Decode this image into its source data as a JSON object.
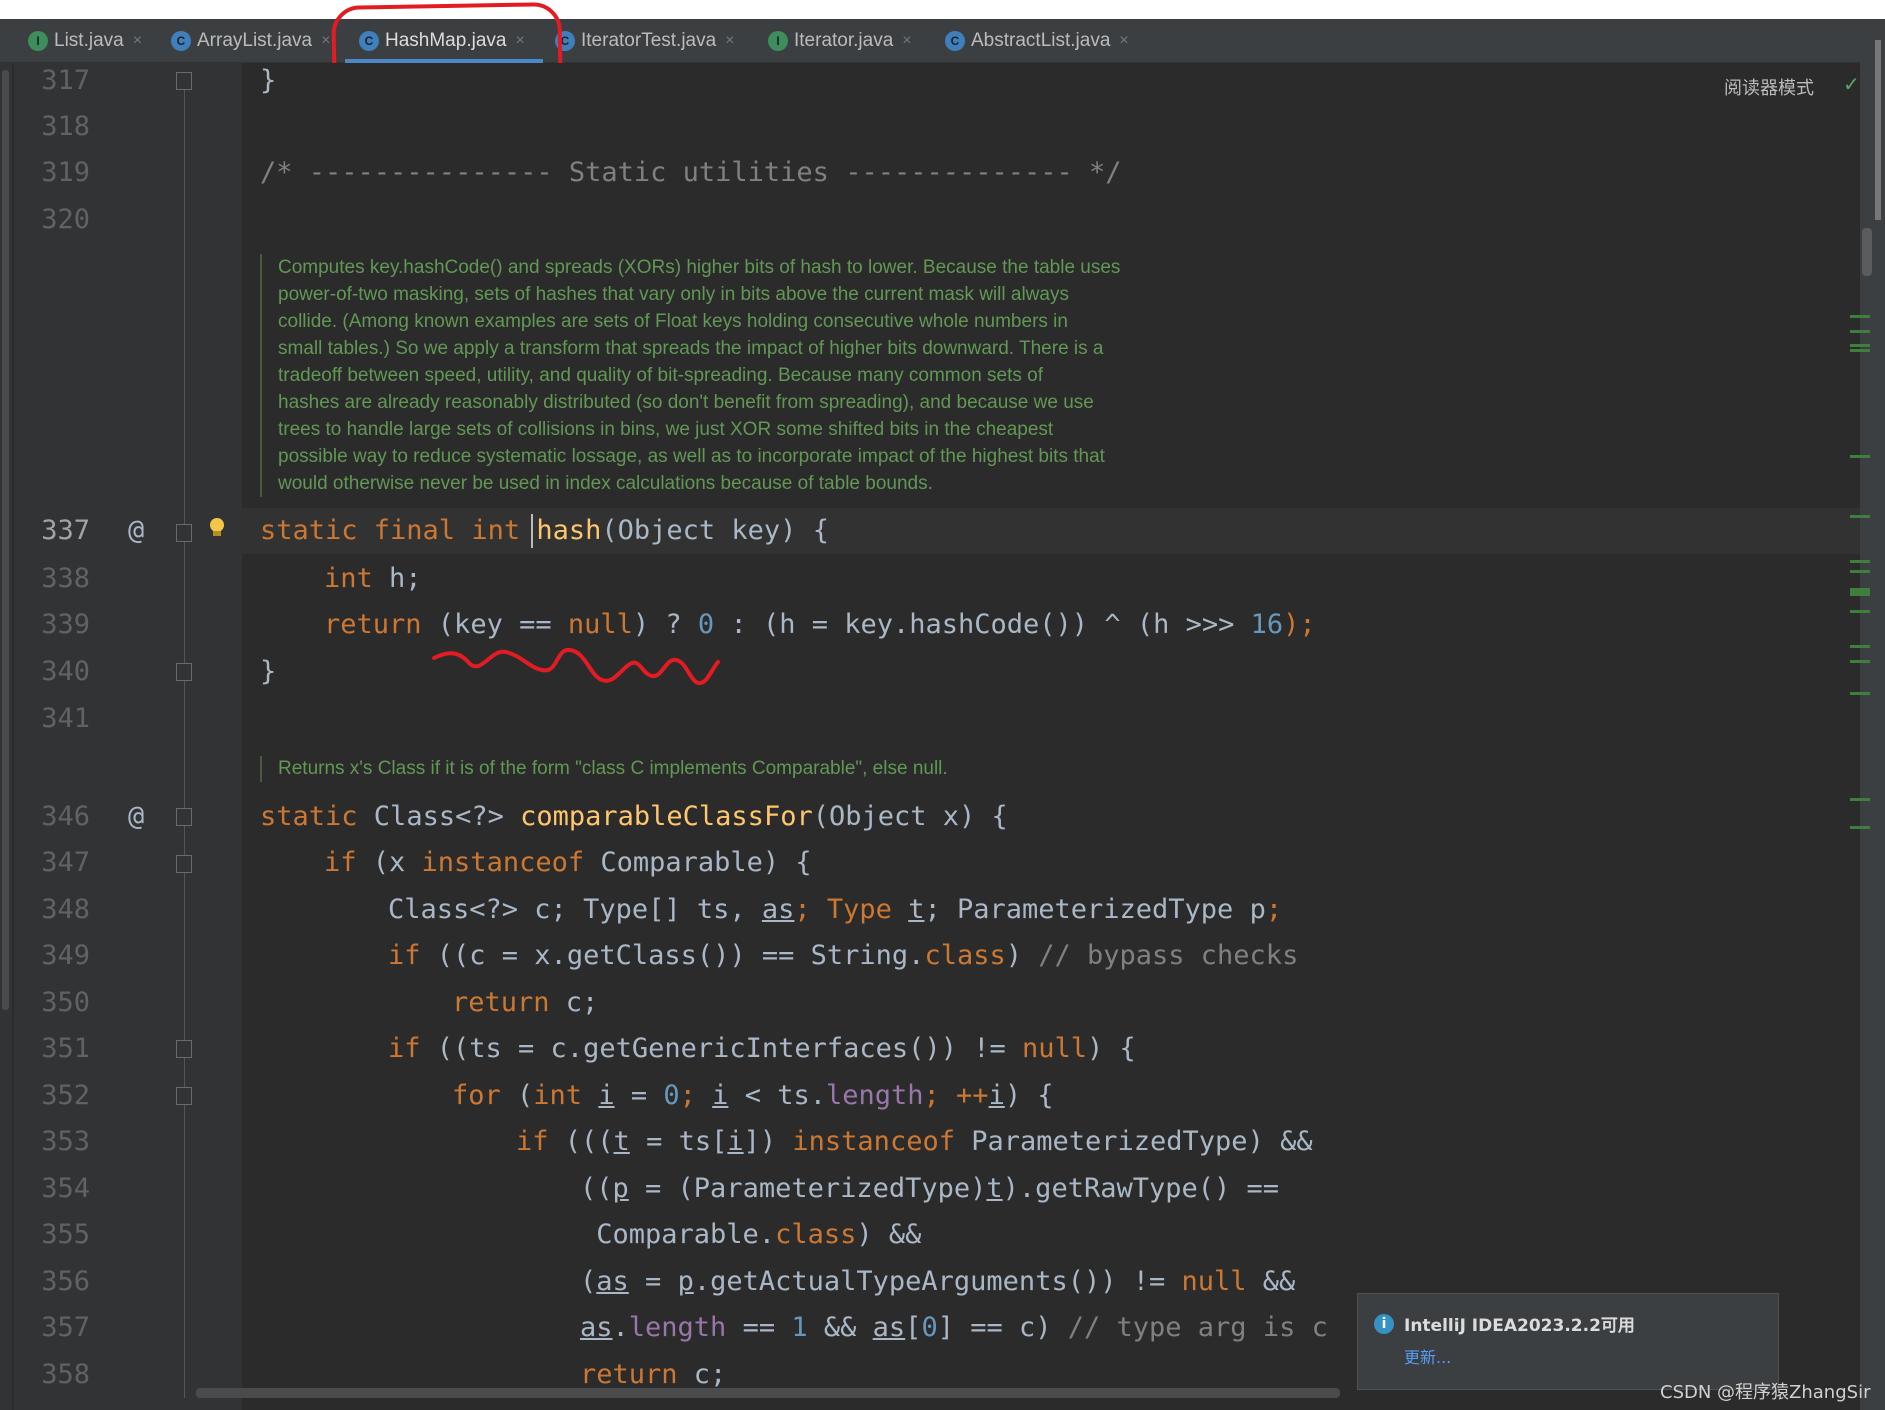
{
  "tabs": [
    {
      "label": "List.java",
      "icon": "interface-icon",
      "icon_letter": "I"
    },
    {
      "label": "ArrayList.java",
      "icon": "class-icon",
      "icon_letter": "C"
    },
    {
      "label": "HashMap.java",
      "icon": "class-icon",
      "icon_letter": "C"
    },
    {
      "label": "IteratorTest.java",
      "icon": "class-icon",
      "icon_letter": "C"
    },
    {
      "label": "Iterator.java",
      "icon": "interface-icon",
      "icon_letter": "I"
    },
    {
      "label": "AbstractList.java",
      "icon": "abstract-class-icon",
      "icon_letter": "C"
    }
  ],
  "active_tab": "HashMap.java",
  "reader_mode": "阅读器模式",
  "line_numbers": [
    "317",
    "318",
    "319",
    "320",
    "337",
    "338",
    "339",
    "340",
    "341",
    "346",
    "347",
    "348",
    "349",
    "350",
    "351",
    "352",
    "353",
    "354",
    "355",
    "356",
    "357",
    "358"
  ],
  "doc_hash": "Computes key.hashCode() and spreads (XORs) higher bits of hash to lower. Because the table uses\npower-of-two masking, sets of hashes that vary only in bits above the current mask will always\ncollide. (Among known examples are sets of Float keys holding consecutive whole numbers in\nsmall tables.) So we apply a transform that spreads the impact of higher bits downward. There is a\ntradeoff between speed, utility, and quality of bit-spreading. Because many common sets of\nhashes are already reasonably distributed (so don't benefit from spreading), and because we use\ntrees to handle large sets of collisions in bins, we just XOR some shifted bits in the cheapest\npossible way to reduce systematic lossage, as well as to incorporate impact of the highest bits that\nwould otherwise never be used in index calculations because of table bounds.",
  "doc_comparable": "Returns x's Class if it is of the form \"class C implements Comparable\", else null.",
  "code": {
    "l317": "}",
    "l319": "/* --------------- Static utilities -------------- */",
    "l337": {
      "kw": "static final int ",
      "fn": "hash",
      "rest": "(Object key) {"
    },
    "l338": {
      "kw": "int",
      "rest": " h;"
    },
    "l339": {
      "kw": "return",
      "a": " (key == ",
      "null": "null",
      "b": ") ? ",
      "n0": "0",
      "c": " : (h = key.hashCode()) ^ (h >>> ",
      "n16": "16",
      "d": ");"
    },
    "l340": "}",
    "l346": {
      "kw": "static",
      "a": " Class<?> ",
      "fn": "comparableClassFor",
      "rest": "(Object x) {"
    },
    "l347": {
      "kw": "if",
      "a": " (x ",
      "inst": "instanceof",
      "rest": " Comparable) {"
    },
    "l348": {
      "a": "Class<?> c; Type[] ts, ",
      "as": "as",
      "b": "; Type ",
      "t": "t",
      "c": "; ParameterizedType ",
      "p": "p",
      "d": ";"
    },
    "l349": {
      "kw": "if",
      "a": " ((c = x.getClass()) == String.",
      "cls": "class",
      "b": ") ",
      "cmt": "// bypass checks"
    },
    "l350": {
      "kw": "return",
      "rest": " c;"
    },
    "l351": {
      "kw": "if",
      "a": " ((ts = c.getGenericInterfaces()) != ",
      "null": "null",
      "b": ") {"
    },
    "l352": {
      "kw": "for",
      "a": " (",
      "int": "int",
      "b": " ",
      "i1": "i",
      "c": " = ",
      "n0": "0",
      "d": "; ",
      "i2": "i",
      "e": " < ts.",
      "len": "length",
      "f": "; ++",
      "i3": "i",
      "g": ") {"
    },
    "l353": {
      "kw": "if",
      "a": " (((",
      "t": "t",
      "b": " = ts[",
      "i": "i",
      "c": "]) ",
      "inst": "instanceof",
      "d": " ParameterizedType) &&"
    },
    "l354": {
      "a": "((",
      "p": "p",
      "b": " = (ParameterizedType)",
      "t": "t",
      "c": ").getRawType() =="
    },
    "l355": {
      "a": " Comparable.",
      "cls": "class",
      "b": ") &&"
    },
    "l356": {
      "a": "(",
      "as": "as",
      "b": " = ",
      "p": "p",
      "c": ".getActualTypeArguments()) != ",
      "null": "null",
      "d": " &&"
    },
    "l357": {
      "as": "as",
      "a": ".",
      "len": "length",
      "b": " == ",
      "n1": "1",
      "c": " && ",
      "as2": "as",
      "d": "[",
      "n0": "0",
      "e": "] == c) ",
      "cmt": "// type arg is c"
    },
    "l358": {
      "kw": "return",
      "rest": " c;"
    }
  },
  "notification": {
    "title": "IntelliJ IDEA2023.2.2可用",
    "link": "更新..."
  },
  "watermark": "CSDN @程序猿ZhangSir",
  "colors": {
    "keyword": "#cc7832",
    "function": "#ffc66d",
    "number": "#6897bb",
    "doc": "#629755",
    "field": "#9876aa",
    "annotation_red": "#e31b23"
  }
}
